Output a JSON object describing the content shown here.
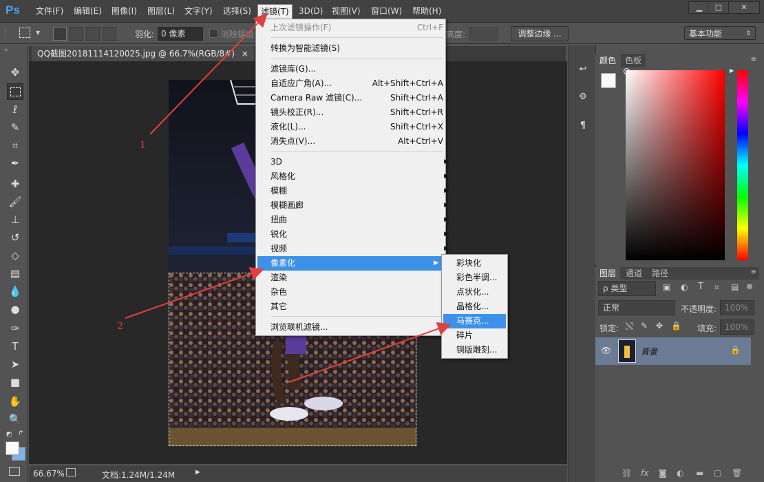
{
  "app": {
    "logo": "Ps"
  },
  "menubar": {
    "items": [
      "文件(F)",
      "编辑(E)",
      "图像(I)",
      "图层(L)",
      "文字(Y)",
      "选择(S)",
      "滤镜(T)",
      "3D(D)",
      "视图(V)",
      "窗口(W)",
      "帮助(H)"
    ],
    "window_buttons": [
      "▁",
      "□",
      "✕"
    ]
  },
  "options": {
    "feather_label": "羽化:",
    "feather_value": "0 像素",
    "antialias_label": "消除锯齿",
    "height_label": "高度:",
    "refine_edge_button": "调整边缘 ...",
    "workspace": "基本功能"
  },
  "document": {
    "tab_title": "QQ截图20181114120025.jpg @ 66.7%(RGB/8#)",
    "tab_close": "×",
    "zoom": "66.67%",
    "doc_info": "文档:1.24M/1.24M"
  },
  "filter_menu": {
    "items": [
      {
        "label": "上次滤镜操作(F)",
        "shortcut": "Ctrl+F",
        "disabled": true
      },
      {
        "label": "转换为智能滤镜(S)"
      },
      {
        "label": "滤镜库(G)..."
      },
      {
        "label": "自适应广角(A)...",
        "shortcut": "Alt+Shift+Ctrl+A"
      },
      {
        "label": "Camera Raw 滤镜(C)...",
        "shortcut": "Shift+Ctrl+A"
      },
      {
        "label": "镜头校正(R)...",
        "shortcut": "Shift+Ctrl+R"
      },
      {
        "label": "液化(L)...",
        "shortcut": "Shift+Ctrl+X"
      },
      {
        "label": "消失点(V)...",
        "shortcut": "Alt+Ctrl+V"
      },
      {
        "label": "3D",
        "submenu": true
      },
      {
        "label": "风格化",
        "submenu": true
      },
      {
        "label": "模糊",
        "submenu": true
      },
      {
        "label": "模糊画廊",
        "submenu": true
      },
      {
        "label": "扭曲",
        "submenu": true
      },
      {
        "label": "锐化",
        "submenu": true
      },
      {
        "label": "视频",
        "submenu": true
      },
      {
        "label": "像素化",
        "submenu": true,
        "highlighted": true
      },
      {
        "label": "渲染",
        "submenu": true
      },
      {
        "label": "杂色",
        "submenu": true
      },
      {
        "label": "其它",
        "submenu": true
      },
      {
        "label": "浏览联机滤镜..."
      }
    ]
  },
  "pixelate_submenu": {
    "items": [
      {
        "label": "彩块化"
      },
      {
        "label": "彩色半调..."
      },
      {
        "label": "点状化..."
      },
      {
        "label": "晶格化..."
      },
      {
        "label": "马赛克...",
        "highlighted": true
      },
      {
        "label": "碎片"
      },
      {
        "label": "铜版雕刻..."
      }
    ]
  },
  "annotations": [
    "1",
    "2"
  ],
  "color_panel": {
    "tabs": [
      "颜色",
      "色板"
    ]
  },
  "layers_panel": {
    "tabs": [
      "图层",
      "通道",
      "路径"
    ],
    "filter_kind": "ρ 类型",
    "blend_mode": "正常",
    "opacity_label": "不透明度:",
    "opacity_value": "100%",
    "lock_label": "锁定:",
    "fill_label": "填充:",
    "fill_value": "100%",
    "layer_name": "背景"
  },
  "colors": {
    "menu_highlight": "#3e91e8",
    "annotation": "#e04040",
    "panel": "#535353"
  }
}
